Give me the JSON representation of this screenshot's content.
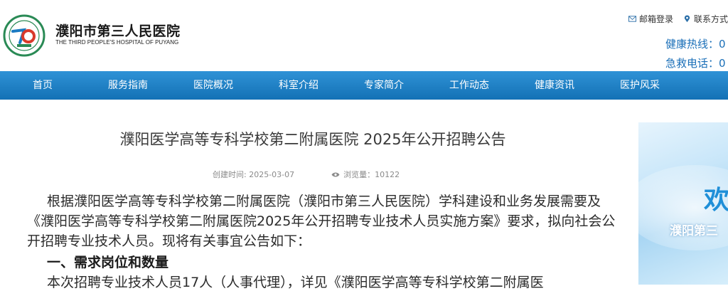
{
  "header": {
    "brand_cn": "濮阳市第三人民医院",
    "brand_en": "THE THIRD PEOPLE'S HOSPITAL OF PUYANG",
    "toplinks": {
      "mail_label": "邮箱登录",
      "contact_label": "联系方式"
    },
    "hotline": "健康热线：0",
    "emergency": "急救电话：0"
  },
  "nav": {
    "items": [
      "首页",
      "服务指南",
      "医院概况",
      "科室介绍",
      "专家简介",
      "工作动态",
      "健康资讯",
      "医护风采"
    ]
  },
  "article": {
    "title": "濮阳医学高等专科学校第二附属医院 2025年公开招聘公告",
    "created_label": "创建时间: ",
    "created_date": "2025-03-07",
    "views_label": "浏览量：",
    "views_count": "10122",
    "paragraph_1": "根据濮阳医学高等专科学校第二附属医院（濮阳市第三人民医院）学科建设和业务发展需要及《濮阳医学高等专科学校第二附属医院2025年公开招聘专业技术人员实施方案》要求，拟向社会公开招聘专业技术人员。现将有关事宜公告如下：",
    "section_1": "一、需求岗位和数量",
    "paragraph_2": "本次招聘专业技术人员17人（人事代理），详见《濮阳医学高等专科学校第二附属医"
  },
  "banner": {
    "welcome": "欢",
    "subtitle": "濮阳第三"
  },
  "colors": {
    "nav_top": "#2f92d6",
    "nav_bottom": "#1371b5",
    "hotline": "#1a6fb8"
  }
}
